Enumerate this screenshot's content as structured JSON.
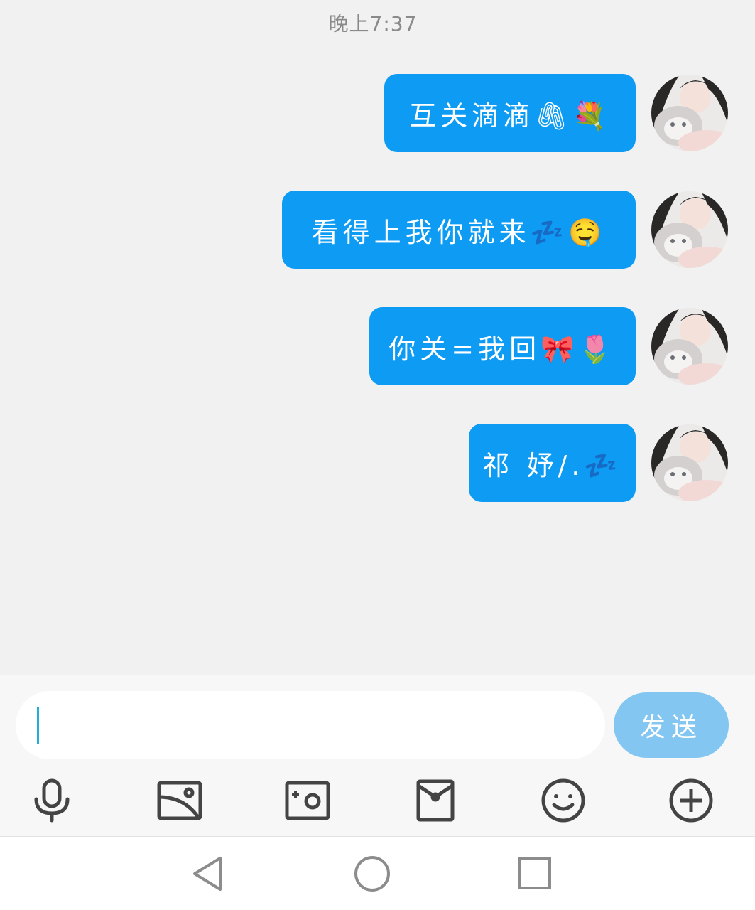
{
  "status": {
    "time": "晚上7:37"
  },
  "messages": [
    {
      "text": "互关滴滴🖇💐"
    },
    {
      "text": "看得上我你就来💤🤤"
    },
    {
      "text": "你关=我回🎀🌷"
    },
    {
      "text": "祁 妤/.💤"
    }
  ],
  "composer": {
    "input_value": "",
    "send_label": "发送"
  },
  "toolbar": {
    "icons": [
      "microphone-icon",
      "image-icon",
      "camera-icon",
      "red-packet-icon",
      "emoji-icon",
      "plus-icon"
    ]
  },
  "navbar": {
    "icons": [
      "back-icon",
      "home-icon",
      "recents-icon"
    ]
  },
  "colors": {
    "bubble": "#0d9bf4",
    "send_button": "#84c6f2",
    "background": "#f1f1f1",
    "caret": "#1fb0d8"
  }
}
